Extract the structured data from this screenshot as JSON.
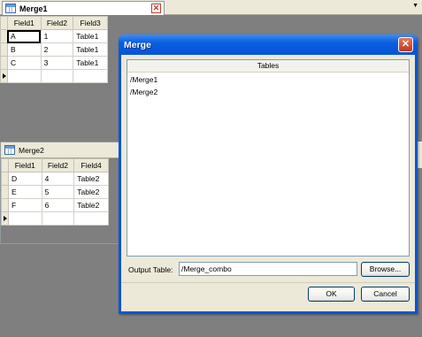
{
  "tab": {
    "title": "Merge1",
    "close": "✕"
  },
  "strip": {
    "arrow": "▼"
  },
  "grid1": {
    "columns": [
      "Field1",
      "Field2",
      "Field3"
    ],
    "rows": [
      [
        "A",
        "1",
        "Table1"
      ],
      [
        "B",
        "2",
        "Table1"
      ],
      [
        "C",
        "3",
        "Table1"
      ]
    ]
  },
  "subwin": {
    "title": "Merge2"
  },
  "grid2": {
    "columns": [
      "Field1",
      "Field2",
      "Field4"
    ],
    "rows": [
      [
        "D",
        "4",
        "Table2"
      ],
      [
        "E",
        "5",
        "Table2"
      ],
      [
        "F",
        "6",
        "Table2"
      ]
    ]
  },
  "dialog": {
    "title": "Merge",
    "close": "✕",
    "list_header": "Tables",
    "tables": [
      "/Merge1",
      "/Merge2"
    ],
    "output_label": "Output Table:",
    "output_value": "/Merge_combo",
    "browse": "Browse...",
    "ok": "OK",
    "cancel": "Cancel"
  }
}
